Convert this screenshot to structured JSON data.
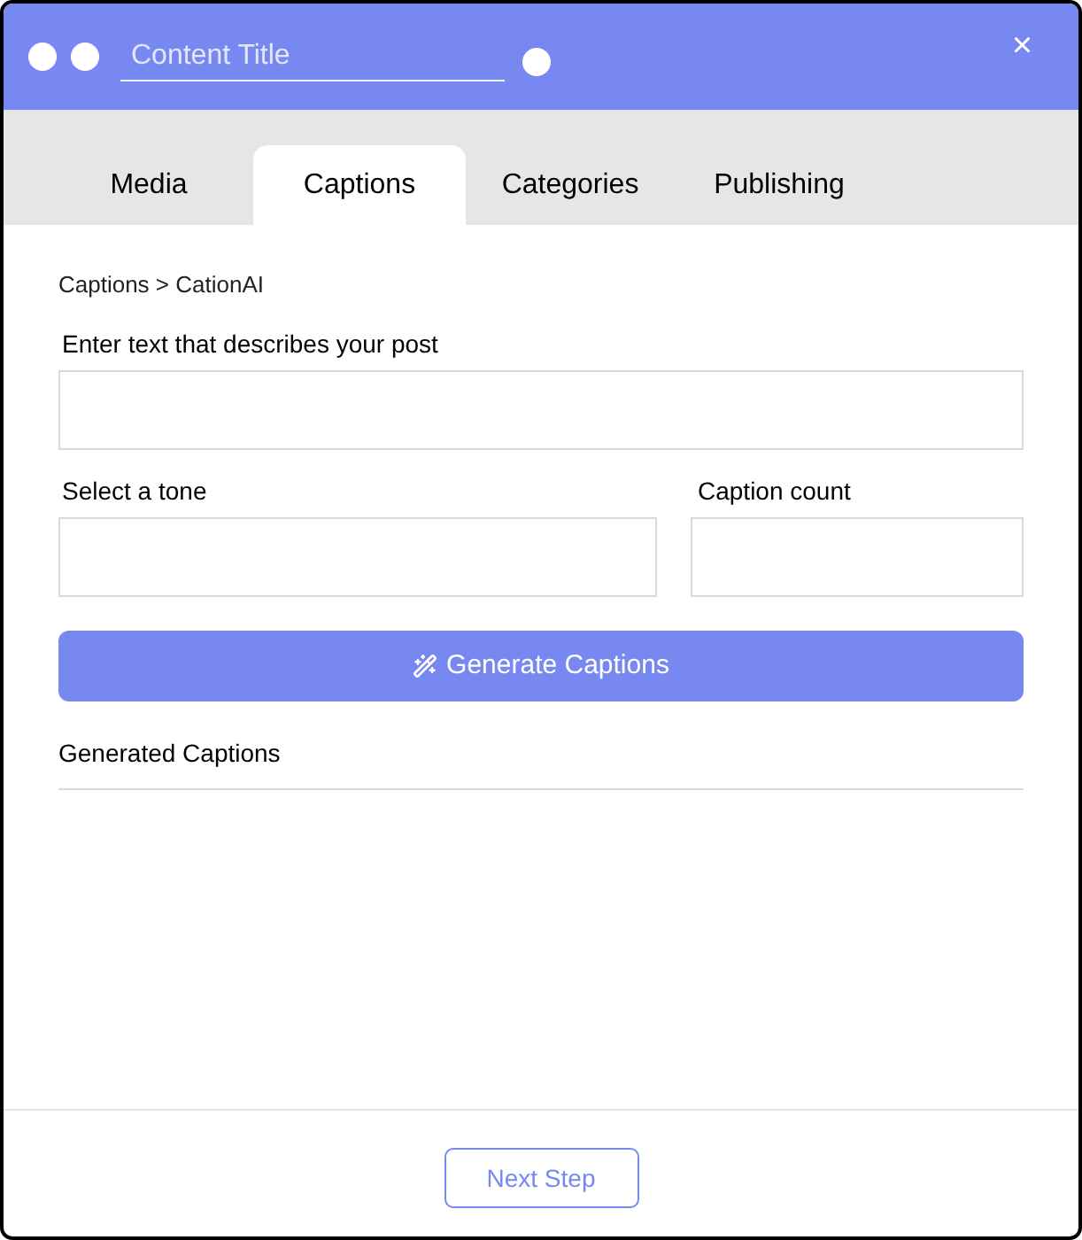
{
  "window": {
    "title_field": {
      "placeholder": "Content Title"
    },
    "close": "×"
  },
  "tabs": [
    {
      "label": "Media",
      "selected": false
    },
    {
      "label": "Captions",
      "selected": true
    },
    {
      "label": "Categories",
      "selected": false
    },
    {
      "label": "Publishing",
      "selected": false
    }
  ],
  "breadcrumb": "Captions > CationAI",
  "form": {
    "description": {
      "label": "Enter text that describes your post"
    },
    "tone": {
      "label": "Select a tone"
    },
    "count": {
      "label": "Caption count"
    }
  },
  "generate_button": "Generate Captions",
  "results": {
    "heading": "Generated Captions"
  },
  "footer": {
    "next_button": "Next Step"
  }
}
